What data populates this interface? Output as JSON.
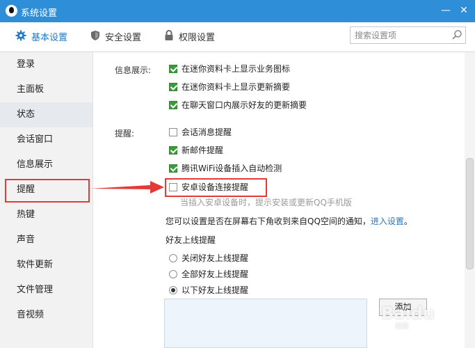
{
  "window": {
    "title": "系统设置",
    "minimize_glyph": "—",
    "close_glyph": "✕"
  },
  "tabs": [
    {
      "label": "基本设置",
      "icon": "gear-icon",
      "active": true
    },
    {
      "label": "安全设置",
      "icon": "shield-icon",
      "active": false
    },
    {
      "label": "权限设置",
      "icon": "lock-icon",
      "active": false
    }
  ],
  "search": {
    "placeholder": "搜索设置项",
    "icon": "search-icon"
  },
  "sidebar": {
    "items": [
      {
        "label": "登录"
      },
      {
        "label": "主面板"
      },
      {
        "label": "状态"
      },
      {
        "label": "会话窗口"
      },
      {
        "label": "信息展示"
      },
      {
        "label": "提醒"
      },
      {
        "label": "热键"
      },
      {
        "label": "声音"
      },
      {
        "label": "软件更新"
      },
      {
        "label": "文件管理"
      },
      {
        "label": "音视频"
      }
    ]
  },
  "info_display": {
    "label": "信息展示:",
    "options": [
      {
        "label": "在迷你资料卡上显示业务图标",
        "checked": true
      },
      {
        "label": "在迷你资料卡上显示更新摘要",
        "checked": true
      },
      {
        "label": "在聊天窗口内展示好友的更新摘要",
        "checked": true
      }
    ]
  },
  "reminder": {
    "label": "提醒:",
    "options": [
      {
        "label": "会话消息提醒",
        "checked": false
      },
      {
        "label": "新邮件提醒",
        "checked": true
      },
      {
        "label": "腾讯WiFi设备插入自动检测",
        "checked": true
      },
      {
        "label": "安卓设备连接提醒",
        "checked": false
      }
    ],
    "android_hint": "当插入安卓设备时，提示安装或更新QQ手机版",
    "qzone_text": "您可以设置是否在屏幕右下角收到来自QQ空间的通知，",
    "qzone_link": "进入设置",
    "qzone_end": "。"
  },
  "friend_online": {
    "label": "好友上线提醒",
    "options": [
      {
        "label": "关闭好友上线提醒",
        "selected": false
      },
      {
        "label": "全部好友上线提醒",
        "selected": false
      },
      {
        "label": "以下好友上线提醒",
        "selected": true
      }
    ],
    "add_button": "添加"
  },
  "watermark": {
    "text": "Baidu",
    "sub": "经验"
  },
  "colors": {
    "titlebar": "#2e8fd8",
    "accent": "#1f79c7",
    "check_green": "#3a9a3c",
    "annotation_red": "#e53935"
  }
}
